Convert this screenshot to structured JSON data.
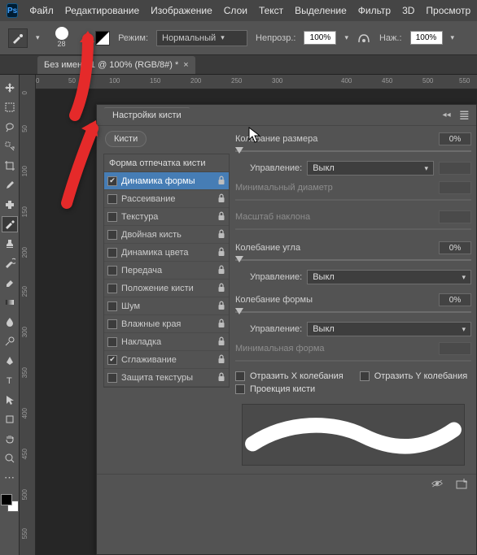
{
  "app": {
    "logo": "Ps"
  },
  "menu": {
    "file": "Файл",
    "edit": "Редактирование",
    "image": "Изображение",
    "layers": "Слои",
    "text": "Текст",
    "select": "Выделение",
    "filter": "Фильтр",
    "threeD": "3D",
    "view": "Просмотр"
  },
  "options": {
    "brush_size": "28",
    "mode_label": "Режим:",
    "mode_value": "Нормальный",
    "opacity_label": "Непрозр.:",
    "opacity_value": "100%",
    "pressure_label": "Наж.:",
    "pressure_value": "100%"
  },
  "document": {
    "tab_title": "Без имени-1 @ 100% (RGB/8#) *"
  },
  "ruler_h": [
    "0",
    "50",
    "100",
    "150",
    "200",
    "250",
    "300",
    "400",
    "450",
    "500",
    "550"
  ],
  "ruler_v": [
    "0",
    "50",
    "100",
    "150",
    "200",
    "250",
    "300",
    "350",
    "400",
    "450",
    "500",
    "550"
  ],
  "panel": {
    "title": "Настройки кисти",
    "brushes_btn": "Кисти",
    "list_header": "Форма отпечатка кисти",
    "rows": [
      {
        "label": "Динамика формы",
        "checked": true,
        "lock": true,
        "selected": true
      },
      {
        "label": "Рассеивание",
        "checked": false,
        "lock": true
      },
      {
        "label": "Текстура",
        "checked": false,
        "lock": true
      },
      {
        "label": "Двойная кисть",
        "checked": false,
        "lock": true
      },
      {
        "label": "Динамика цвета",
        "checked": false,
        "lock": true
      },
      {
        "label": "Передача",
        "checked": false,
        "lock": true
      },
      {
        "label": "Положение кисти",
        "checked": false,
        "lock": true
      },
      {
        "label": "Шум",
        "checked": false,
        "lock": true
      },
      {
        "label": "Влажные края",
        "checked": false,
        "lock": true
      },
      {
        "label": "Накладка",
        "checked": false,
        "lock": true
      },
      {
        "label": "Сглаживание",
        "checked": true,
        "lock": true
      },
      {
        "label": "Защита текстуры",
        "checked": false,
        "lock": true
      }
    ],
    "opts": {
      "size_jitter_label": "Колебание размера",
      "size_jitter_val": "0%",
      "control_label": "Управление:",
      "control_value": "Выкл",
      "min_diam_label": "Минимальный диаметр",
      "tilt_scale_label": "Масштаб наклона",
      "angle_jitter_label": "Колебание угла",
      "angle_jitter_val": "0%",
      "form_jitter_label": "Колебание формы",
      "form_jitter_val": "0%",
      "min_form_label": "Минимальная форма",
      "flip_x": "Отразить X колебания",
      "flip_y": "Отразить Y колебания",
      "brush_proj": "Проекция кисти"
    }
  }
}
